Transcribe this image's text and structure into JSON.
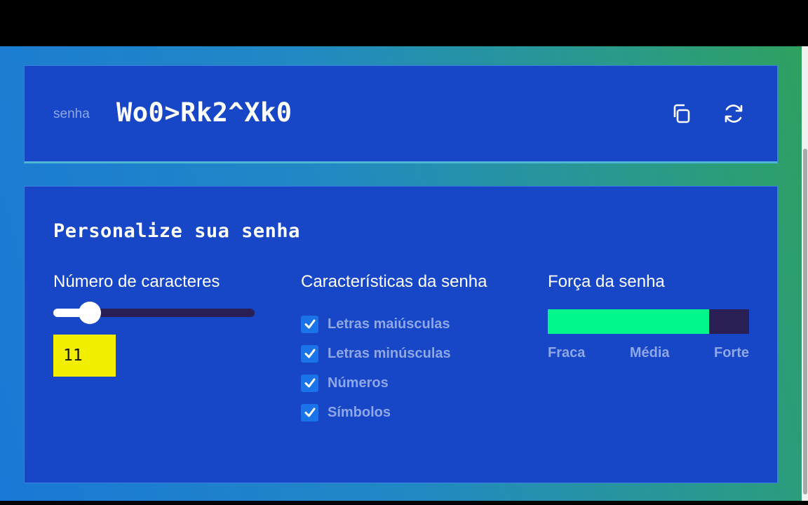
{
  "password": {
    "label": "senha",
    "value": "Wo0>Rk2^Xk0",
    "copy_icon": "copy-icon",
    "refresh_icon": "refresh-icon"
  },
  "settings": {
    "title": "Personalize sua senha",
    "length": {
      "heading": "Número de caracteres",
      "value": "11",
      "slider_level": 0.18
    },
    "features": {
      "heading": "Características da senha",
      "items": [
        {
          "label": "Letras maiúsculas",
          "checked": true
        },
        {
          "label": "Letras minúsculas",
          "checked": true
        },
        {
          "label": "Números",
          "checked": true
        },
        {
          "label": "Símbolos",
          "checked": true
        }
      ]
    },
    "strength": {
      "heading": "Força da senha",
      "level": 0.8,
      "labels": [
        "Fraca",
        "Média",
        "Forte"
      ]
    }
  },
  "colors": {
    "card": "#1746c6",
    "strength_fill": "#00f58b",
    "track": "#2a1f55",
    "length_input": "#f2ee00"
  }
}
